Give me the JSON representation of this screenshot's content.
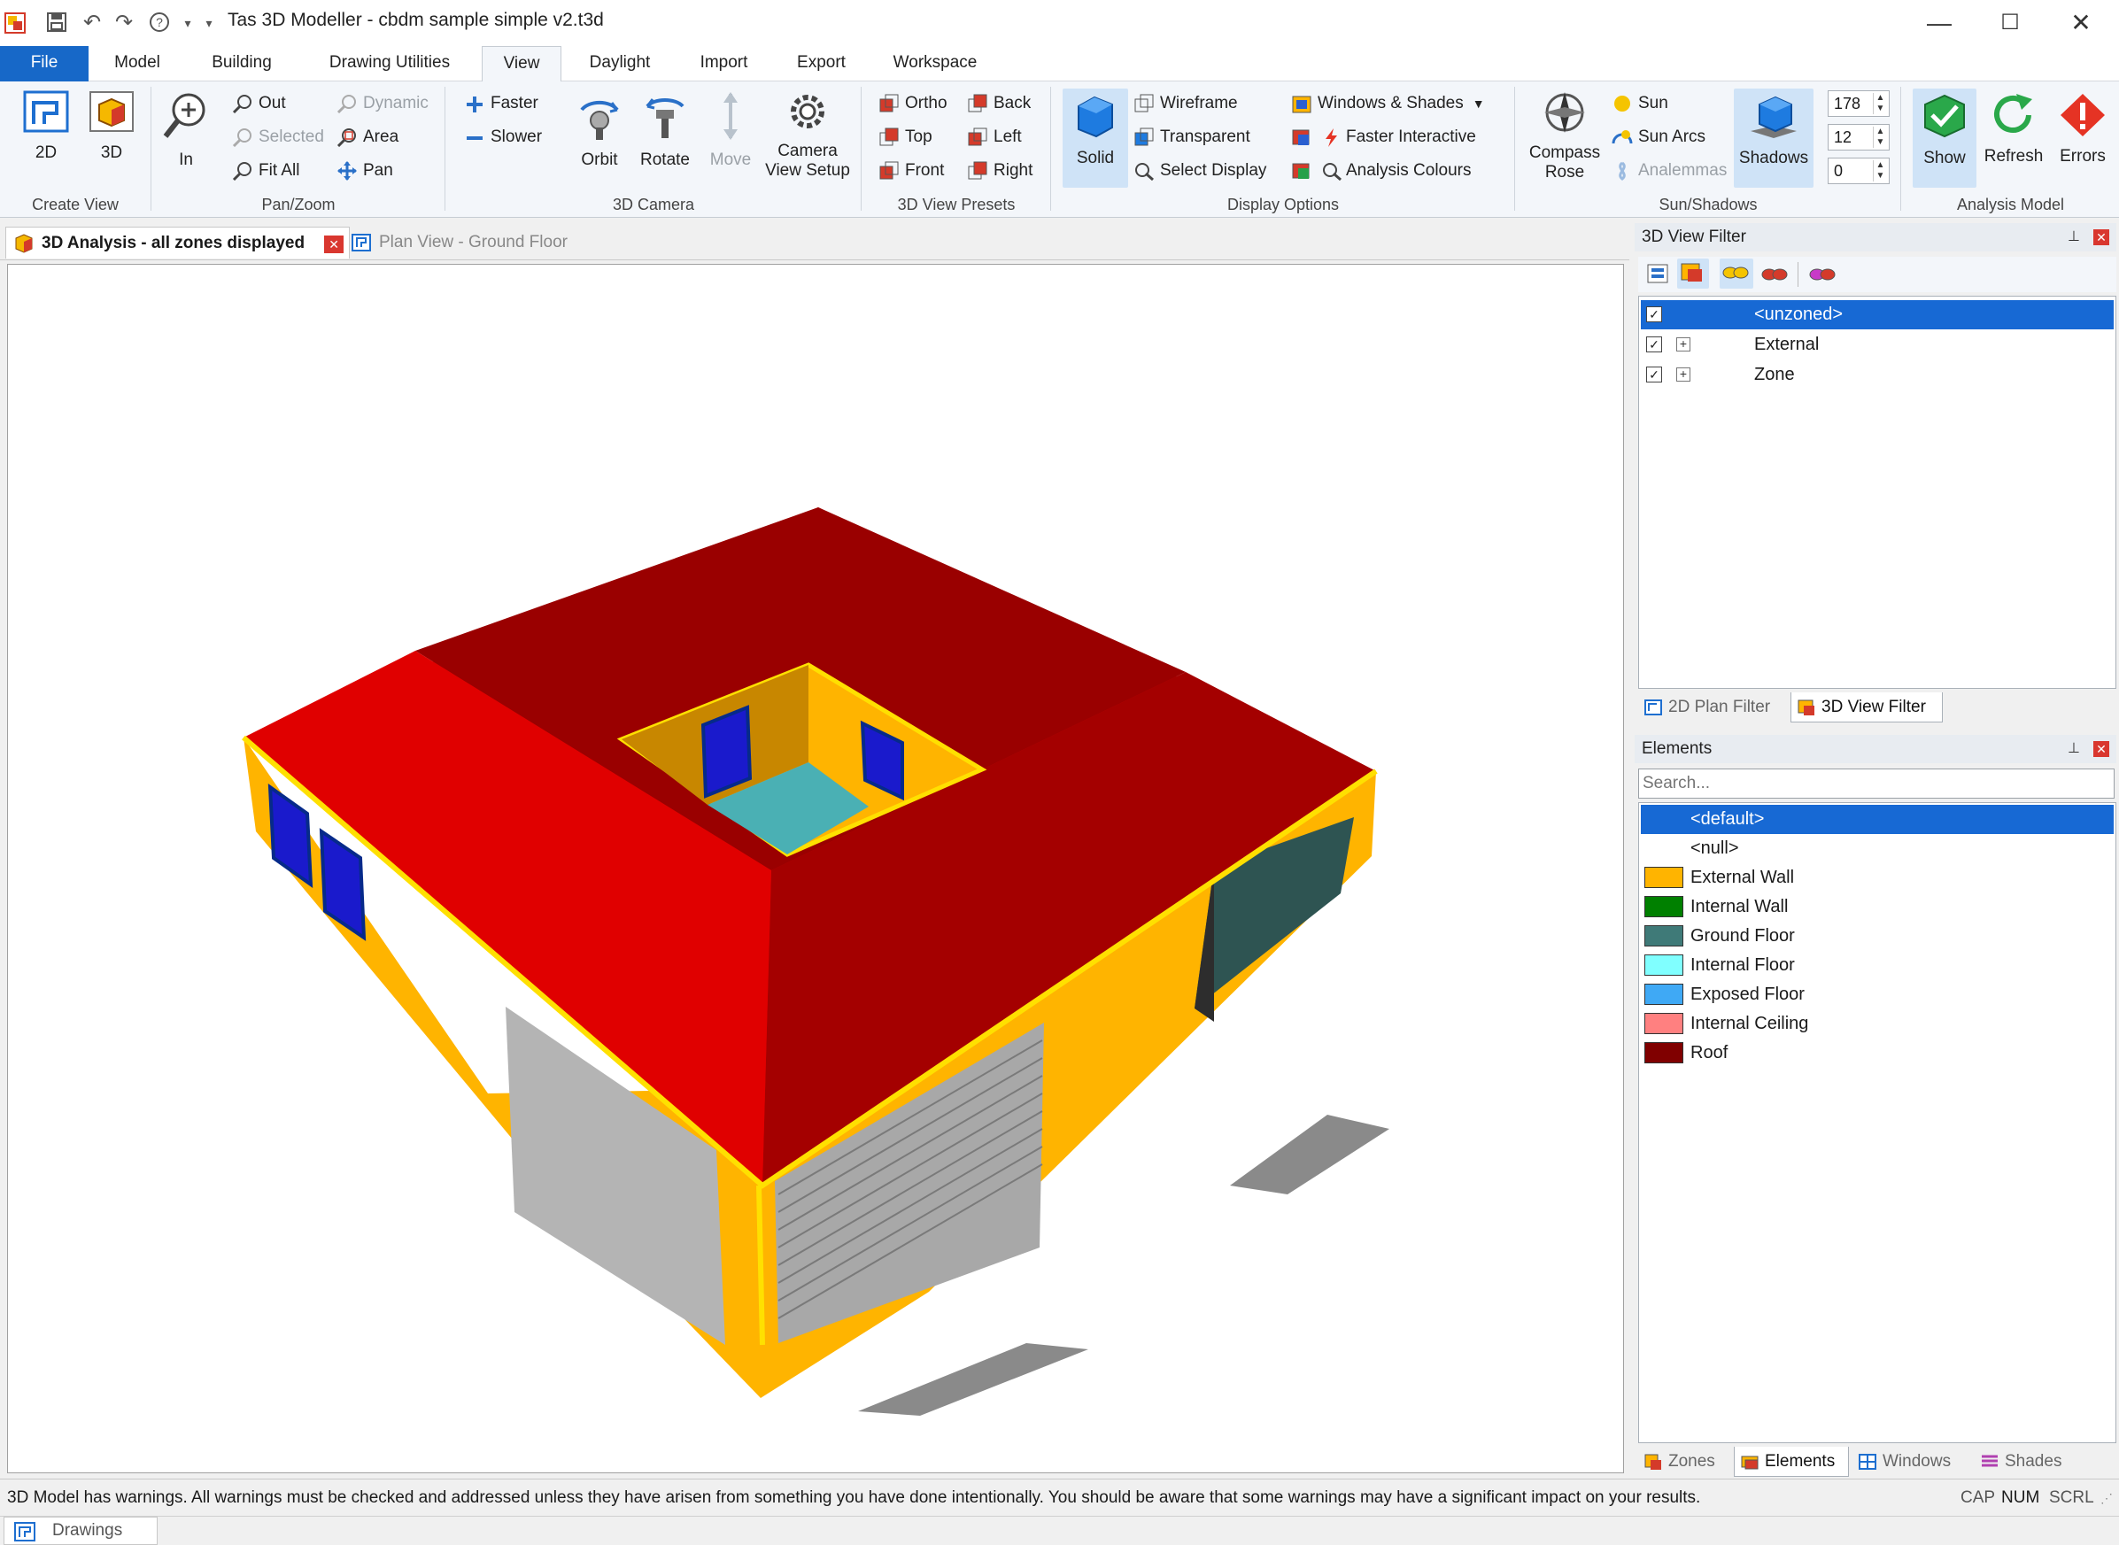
{
  "window": {
    "title": "Tas 3D Modeller - cbdm sample simple v2.t3d"
  },
  "ribbon_tabs": [
    "File",
    "Model",
    "Building",
    "Drawing Utilities",
    "View",
    "Daylight",
    "Import",
    "Export",
    "Workspace"
  ],
  "active_tab": "View",
  "groups": {
    "create_view": {
      "label": "Create View",
      "btn_2d": "2D",
      "btn_3d": "3D"
    },
    "pan_zoom": {
      "label": "Pan/Zoom",
      "in": "In",
      "out": "Out",
      "selected": "Selected",
      "fit_all": "Fit All",
      "dynamic": "Dynamic",
      "area": "Area",
      "pan": "Pan"
    },
    "camera": {
      "label": "3D Camera",
      "faster": "Faster",
      "slower": "Slower",
      "orbit": "Orbit",
      "rotate": "Rotate",
      "move": "Move",
      "camera_setup_1": "Camera",
      "camera_setup_2": "View Setup"
    },
    "presets": {
      "label": "3D View Presets",
      "ortho": "Ortho",
      "top": "Top",
      "front": "Front",
      "back": "Back",
      "left": "Left",
      "right": "Right"
    },
    "display": {
      "label": "Display Options",
      "solid": "Solid",
      "wireframe": "Wireframe",
      "transparent": "Transparent",
      "select_display": "Select Display",
      "windows_shades": "Windows & Shades",
      "faster_interactive": "Faster Interactive",
      "analysis_colours": "Analysis Colours"
    },
    "sun": {
      "label": "Sun/Shadows",
      "compass_1": "Compass",
      "compass_2": "Rose",
      "sun": "Sun",
      "sun_arcs": "Sun Arcs",
      "analemmas": "Analemmas",
      "shadows": "Shadows",
      "v1": "178",
      "v2": "12",
      "v3": "0"
    },
    "analysis": {
      "label": "Analysis Model",
      "show": "Show",
      "refresh": "Refresh",
      "errors": "Errors"
    }
  },
  "doc_tabs": {
    "active": "3D Analysis - all zones displayed",
    "other": "Plan View - Ground Floor"
  },
  "view_filter": {
    "title": "3D View Filter",
    "items": [
      {
        "label": "<unzoned>"
      },
      {
        "label": "External"
      },
      {
        "label": "Zone"
      }
    ],
    "tabs": [
      "2D Plan Filter",
      "3D View Filter"
    ]
  },
  "elements": {
    "title": "Elements",
    "search_placeholder": "Search...",
    "items": [
      {
        "label": "<default>",
        "color": ""
      },
      {
        "label": "<null>",
        "color": ""
      },
      {
        "label": "External Wall",
        "color": "#ffb400"
      },
      {
        "label": "Internal Wall",
        "color": "#008000"
      },
      {
        "label": "Ground Floor",
        "color": "#3f7a78"
      },
      {
        "label": "Internal Floor",
        "color": "#80ffff"
      },
      {
        "label": "Exposed Floor",
        "color": "#3fa9f5"
      },
      {
        "label": "Internal Ceiling",
        "color": "#ff8080"
      },
      {
        "label": "Roof",
        "color": "#800000"
      }
    ],
    "tabs": [
      "Zones",
      "Elements",
      "Windows",
      "Shades"
    ]
  },
  "status": {
    "message": "3D Model has warnings. All warnings must be checked and addressed unless they have arisen from something you have done intentionally. You should be aware that some warnings may have a significant impact on your results.",
    "cap": "CAP",
    "num": "NUM",
    "scrl": "SCRL",
    "bottom_tab": "Drawings"
  }
}
